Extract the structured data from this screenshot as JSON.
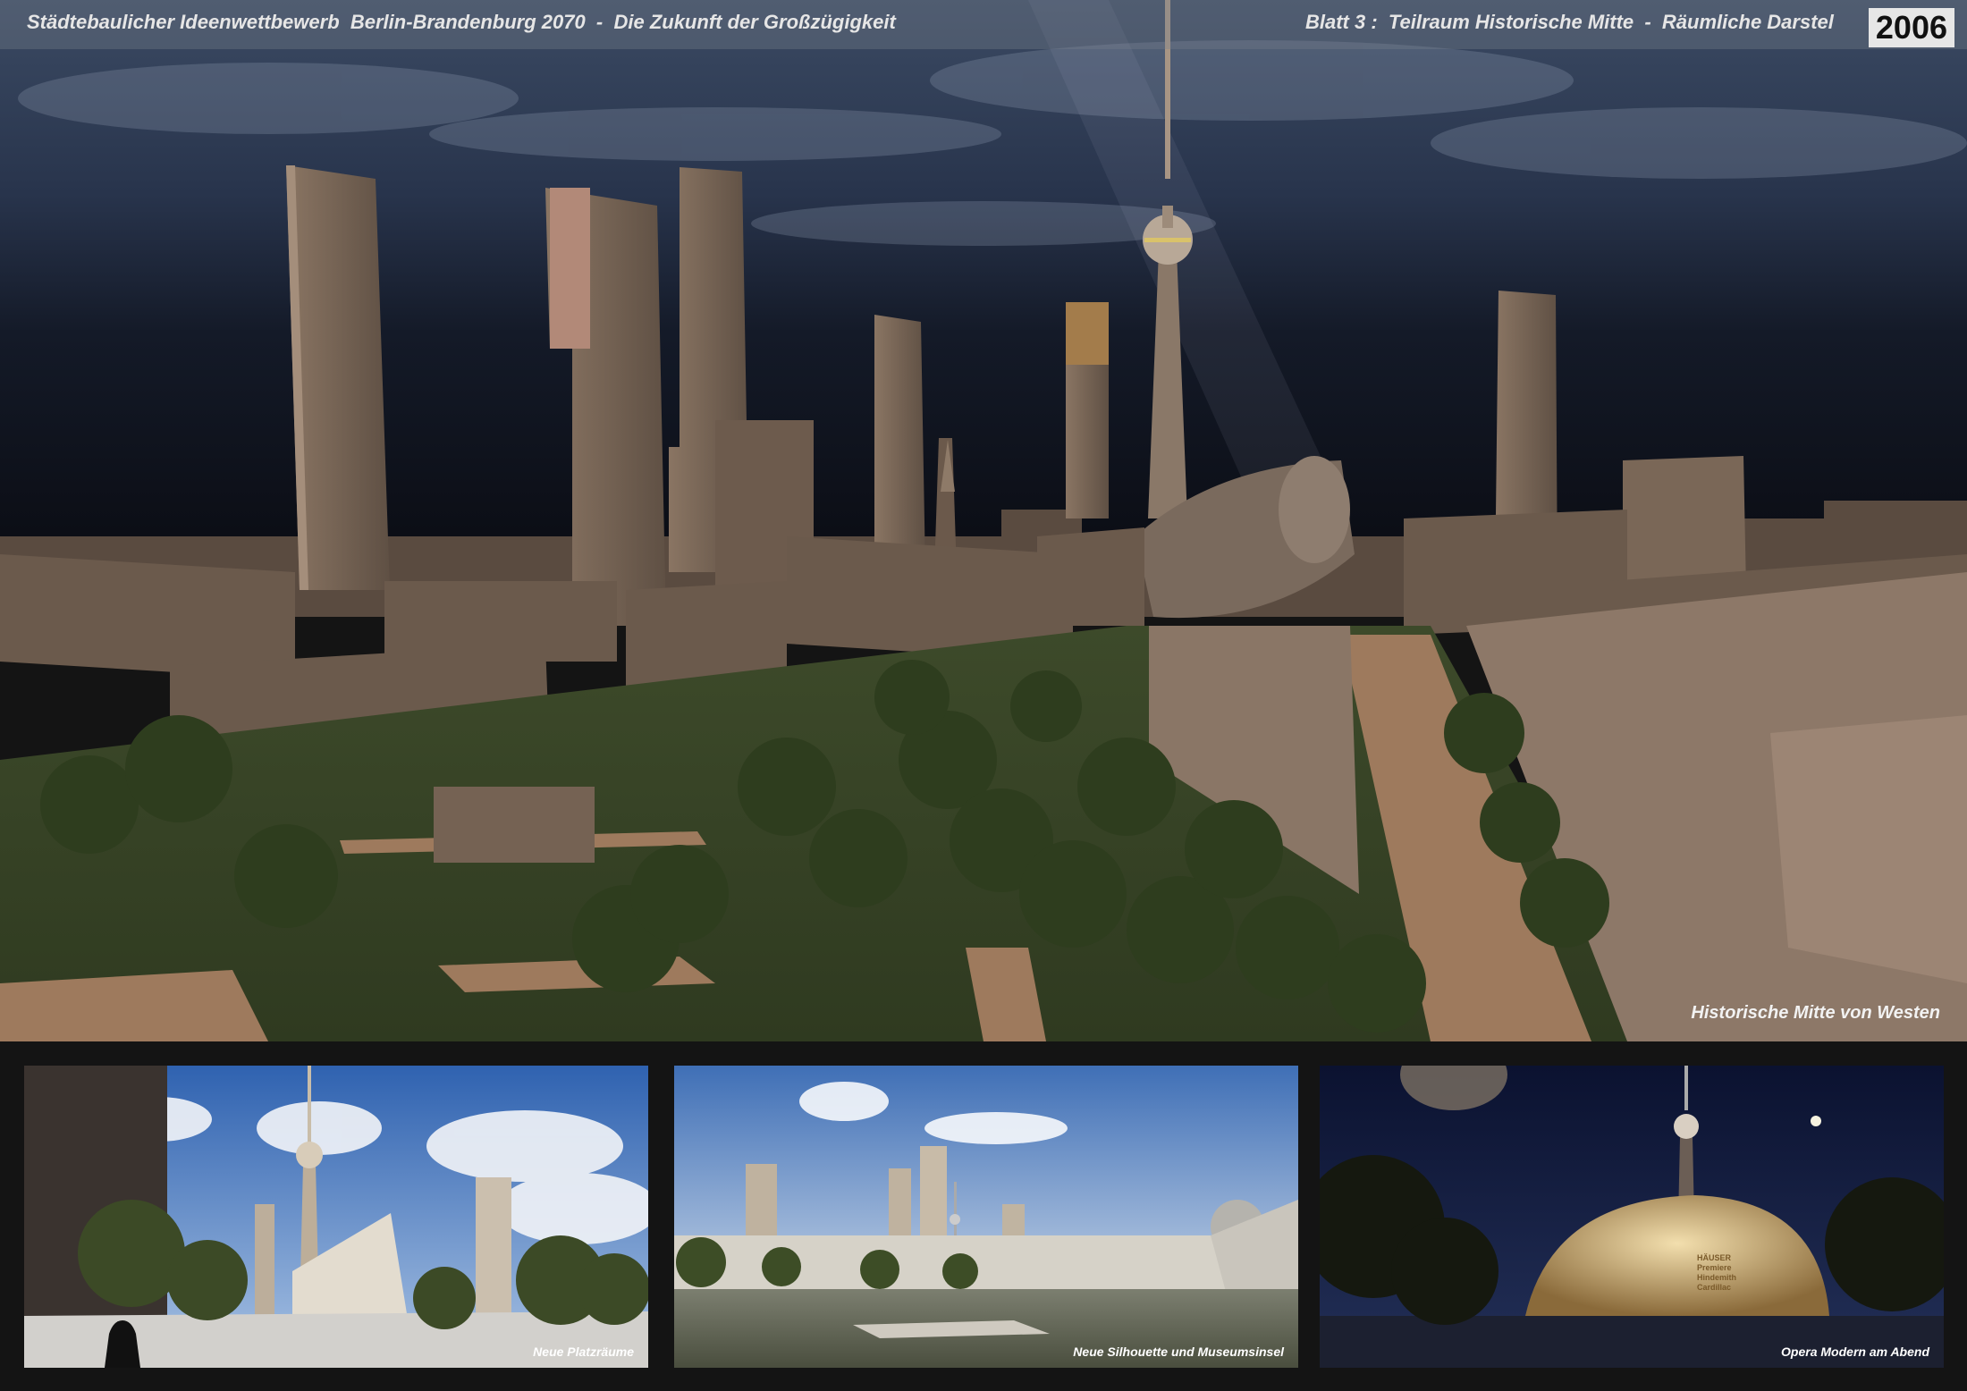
{
  "header": {
    "title_left": "Städtebaulicher Ideenwettbewerb  Berlin-Brandenburg 2070  -  Die Zukunft der Großzügigkeit",
    "title_right": "Blatt 3 :  Teilraum Historische Mitte  -  Räumliche Darstel",
    "year": "2006"
  },
  "hero": {
    "caption": "Historische Mitte von Westen"
  },
  "panels": [
    {
      "caption": "Neue Platzräume"
    },
    {
      "caption": "Neue Silhouette und Museumsinsel"
    },
    {
      "caption": "Opera Modern am Abend",
      "sign_lines": [
        "HÄUSER",
        "Premiere",
        "Hindemith",
        "Cardillac"
      ]
    }
  ]
}
